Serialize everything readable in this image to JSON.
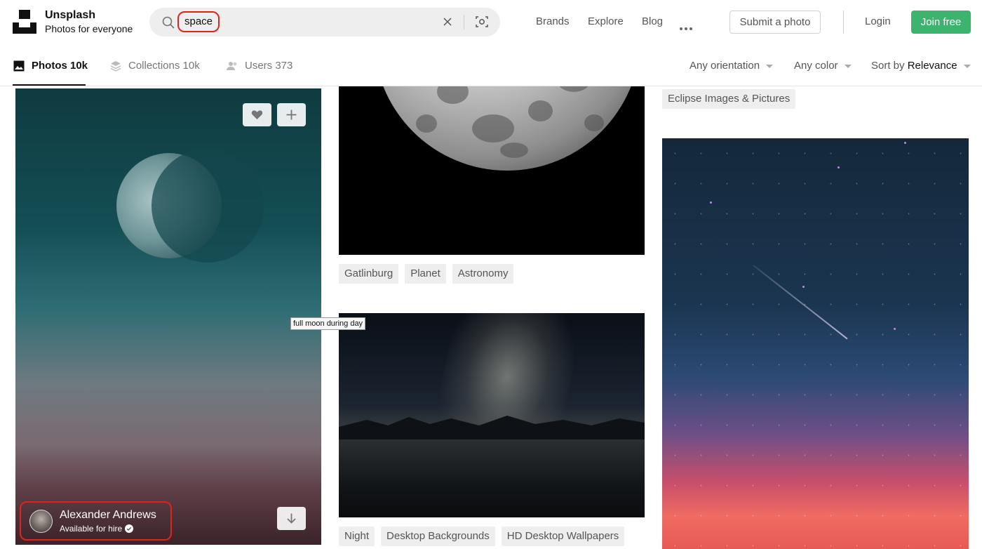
{
  "header": {
    "brand_name": "Unsplash",
    "brand_tagline": "Photos for everyone",
    "search_query": "space",
    "nav": {
      "brands": "Brands",
      "explore": "Explore",
      "blog": "Blog"
    },
    "submit_label": "Submit a photo",
    "login_label": "Login",
    "join_label": "Join free",
    "join_color": "#3cb46e"
  },
  "tabs": [
    {
      "label": "Photos 10k",
      "icon": "image-icon",
      "active": true
    },
    {
      "label": "Collections 10k",
      "icon": "collections-icon",
      "active": false
    },
    {
      "label": "Users 373",
      "icon": "users-icon",
      "active": false
    }
  ],
  "filters": {
    "orientation": "Any orientation",
    "color": "Any color",
    "sort_prefix": "Sort by",
    "sort_value": "Relevance"
  },
  "photos": {
    "first": {
      "author_name": "Alexander Andrews",
      "author_status": "Available for hire"
    },
    "moon_tags": [
      "Gatlinburg",
      "Planet",
      "Astronomy"
    ],
    "night_tags": [
      "Night",
      "Desktop Backgrounds",
      "HD Desktop Wallpapers"
    ],
    "eclipse_tags": [
      "Eclipse Images & Pictures"
    ],
    "tooltip": "full moon during day"
  },
  "highlight_color": "#e0241b"
}
